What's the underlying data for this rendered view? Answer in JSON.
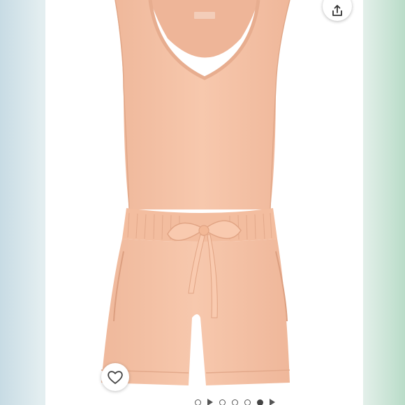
{
  "listing": {
    "image_name": "romper-photo",
    "garment_color": "#f6c3a8"
  },
  "actions": {
    "share_icon": "share-icon",
    "like_icon": "heart-icon"
  },
  "carousel": {
    "items": [
      "dot",
      "video",
      "dot",
      "dot",
      "dot",
      "dot",
      "video"
    ],
    "active_index": 5,
    "total_images": 7
  }
}
